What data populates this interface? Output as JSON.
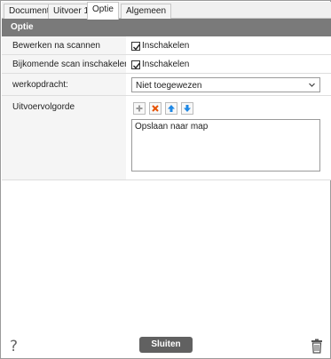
{
  "tabs": [
    {
      "label": "Document"
    },
    {
      "label": "Uitvoer 1"
    },
    {
      "label": "Optie"
    },
    {
      "label": "Algemeen"
    }
  ],
  "active_tab": "Optie",
  "section": {
    "title": "Optie"
  },
  "rows": {
    "edit_after_scan": {
      "label": "Bewerken na scannen",
      "checkbox_label": "Inschakelen",
      "checked": true
    },
    "additional_scan": {
      "label": "Bijkomende scan inschakelen",
      "checkbox_label": "Inschakelen",
      "checked": true
    },
    "workflow": {
      "label": "werkopdracht:",
      "selected": "Niet toegewezen"
    },
    "output_order": {
      "label": "Uitvoervolgorde",
      "items": [
        "Opslaan naar map"
      ]
    }
  },
  "toolbar": {
    "icons": [
      "plus-icon",
      "delete-icon",
      "arrow-up-icon",
      "arrow-down-icon"
    ]
  },
  "footer": {
    "close_label": "Sluiten",
    "help_glyph": "?"
  },
  "colors": {
    "header_bg": "#7a7a7a",
    "close_button_bg": "#616161",
    "accent_blue": "#1e88e5",
    "delete_orange": "#e65100"
  }
}
